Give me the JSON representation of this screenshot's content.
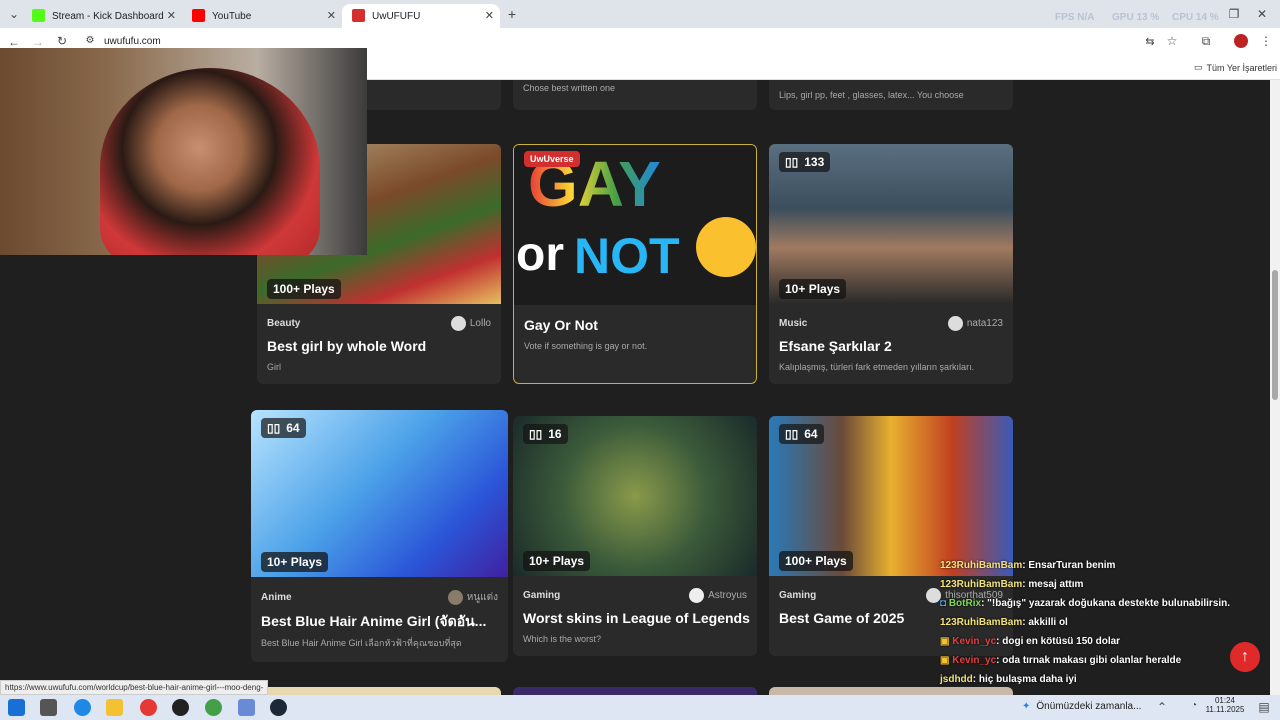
{
  "browser": {
    "tabs": [
      {
        "title": "Stream - Kick Dashboard",
        "color": "#53fc18"
      },
      {
        "title": "YouTube",
        "color": "#ff0000"
      },
      {
        "title": "UwUFUFU",
        "color": "#d32f2f"
      }
    ],
    "new_tab": "+",
    "url": "uwufufu.com",
    "bookmarks_label": "Tüm Yer İşaretleri",
    "perf": [
      {
        "label": "FPS",
        "value": "N/A"
      },
      {
        "label": "GPU",
        "value": "13 %"
      },
      {
        "label": "CPU",
        "value": "14 %"
      }
    ]
  },
  "top_row": [
    {
      "desc": "Chose best written one"
    },
    {
      "desc": "Lips, girl pp, feet , glasses, latex... You choose"
    }
  ],
  "cards": [
    {
      "plays": "100+ Plays",
      "category": "Beauty",
      "author": "Lollo",
      "title": "Best girl by whole Word",
      "desc": "Girl"
    },
    {
      "tag": "UwUverse",
      "title": "Gay Or Not",
      "desc": "Vote if something is gay or not.",
      "image_text_1": "GAY",
      "image_text_2": "or",
      "image_text_3": "NOT"
    },
    {
      "count": "133",
      "plays": "10+ Plays",
      "category": "Music",
      "author": "nata123",
      "title": "Efsane Şarkılar 2",
      "desc": "Kalıplaşmış, türleri fark etmeden yılların şarkıları."
    },
    {
      "count": "64",
      "plays": "10+ Plays",
      "category": "Anime",
      "author": "หนูแต่ง",
      "title": "Best Blue Hair Anime Girl (จัดอัน...",
      "desc": "Best Blue Hair Anime Girl เลือกหัวฟ้าที่คุณชอบที่สุด"
    },
    {
      "count": "16",
      "plays": "10+ Plays",
      "category": "Gaming",
      "author": "Astroyus",
      "title": "Worst skins in League of Legends",
      "desc": "Which is the worst?"
    },
    {
      "count": "64",
      "plays": "100+ Plays",
      "category": "Gaming",
      "author": "thisorthat509",
      "title": "Best Game of 2025",
      "desc": ""
    }
  ],
  "chat": [
    {
      "user": "123RuhiBamBam",
      "text": ": EnsarTuran benim",
      "color": "#f2e27a"
    },
    {
      "user": "123RuhiBamBam",
      "text": ": mesaj attım",
      "color": "#f2e27a"
    },
    {
      "user": "BotRix",
      "text": ": \"!bağış\" yazarak doğukana destekte bulunabilirsin.",
      "color": "#f2e27a"
    },
    {
      "user": "123RuhiBamBam",
      "text": ": akkilli ol",
      "color": "#f2e27a"
    },
    {
      "user": "Kevin_yc",
      "text": ": dogi en kötüsü 150 dolar",
      "color": "#e04040"
    },
    {
      "user": "Kevin_yc",
      "text": ": oda tırnak makası gibi olanlar heralde",
      "color": "#e04040"
    },
    {
      "user": "jsdhdd",
      "text": ": hiç bulaşma daha iyi",
      "color": "#f2e27a"
    }
  ],
  "status_url": "https://www.uwufufu.com/worldcup/best-blue-hair-anime-girl---moo-deng-",
  "taskbar": {
    "weather": "Önümüzdeki zamanla...",
    "time": "01:24",
    "date": "11.11.2025"
  },
  "scroll_top_label": "↑"
}
